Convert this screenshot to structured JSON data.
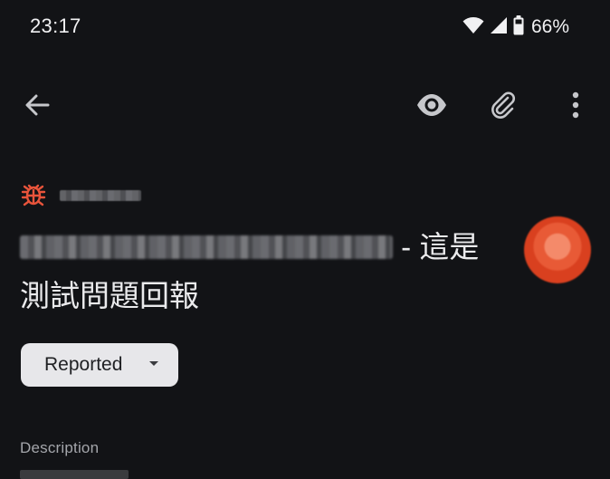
{
  "status_bar": {
    "time": "23:17",
    "battery_percent": "66%",
    "icons": [
      "wifi-icon",
      "cell-signal-icon",
      "battery-icon"
    ]
  },
  "app_bar": {
    "icons": [
      "back-arrow-icon",
      "eye-icon",
      "paperclip-icon",
      "more-vert-icon"
    ]
  },
  "issue": {
    "type_icon": "bug-icon",
    "type_color": "#e8543b",
    "title_suffix": "- 這是",
    "title_line2": "測試問題回報",
    "status_label": "Reported"
  },
  "sections": {
    "description_label": "Description"
  },
  "colors": {
    "background": "#121316",
    "chip_background": "#e7e7ea",
    "avatar": "#e85a36"
  }
}
